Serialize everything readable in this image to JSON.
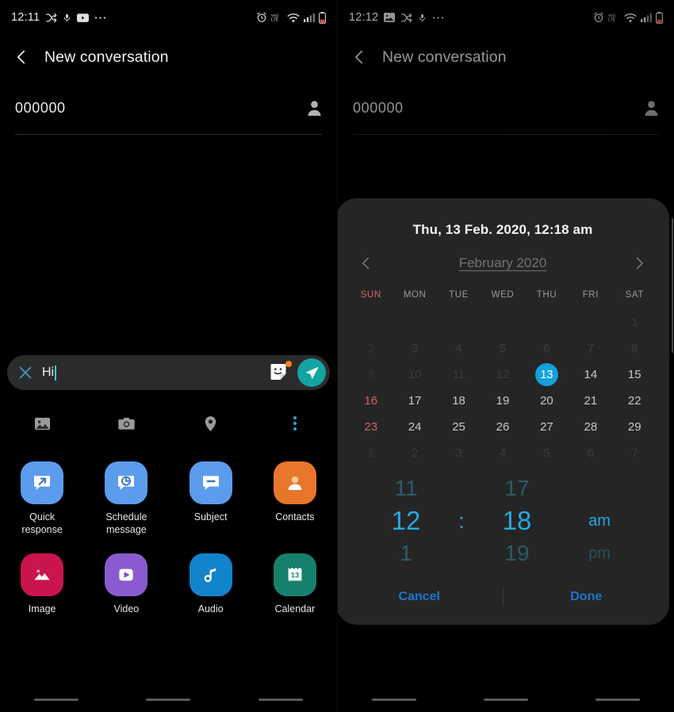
{
  "left_panel": {
    "status_bar": {
      "time": "12:11",
      "left_icons": [
        "shuffle-icon",
        "mic-icon",
        "youtube-icon",
        "more-icon"
      ],
      "right_icons": [
        "alarm-icon",
        "volte-icon",
        "wifi-icon",
        "signal-icon",
        "battery-low-icon"
      ],
      "volte_label": "Vo)) LTE"
    },
    "appbar": {
      "back": "back-chevron-icon",
      "title": "New conversation"
    },
    "recipient": {
      "value": "000000",
      "contact_icon": "person-icon"
    },
    "composer": {
      "close_icon": "close-x-icon",
      "message": "Hi",
      "sticker_icon": "sticker-icon",
      "sticker_badge": true,
      "send_icon": "send-icon",
      "send_color": "#12a3a3"
    },
    "quick_row": [
      "gallery-icon",
      "camera-icon",
      "location-icon",
      "overflow-menu-icon"
    ],
    "attachments": [
      {
        "label": "Quick\nresponse",
        "label_line1": "Quick",
        "label_line2": "response",
        "icon": "quick-response-icon",
        "color": "#5c9ced"
      },
      {
        "label": "Schedule\nmessage",
        "label_line1": "Schedule",
        "label_line2": "message",
        "icon": "schedule-message-icon",
        "color": "#5c9ced"
      },
      {
        "label": "Subject",
        "label_line1": "Subject",
        "label_line2": "",
        "icon": "subject-icon",
        "color": "#5c9ced"
      },
      {
        "label": "Contacts",
        "label_line1": "Contacts",
        "label_line2": "",
        "icon": "contacts-icon",
        "color": "#e8762a"
      },
      {
        "label": "Image",
        "label_line1": "Image",
        "label_line2": "",
        "icon": "image-icon",
        "color": "#c9144e"
      },
      {
        "label": "Video",
        "label_line1": "Video",
        "label_line2": "",
        "icon": "video-icon",
        "color": "#8a5bd0"
      },
      {
        "label": "Audio",
        "label_line1": "Audio",
        "label_line2": "",
        "icon": "audio-icon",
        "color": "#1184cc"
      },
      {
        "label": "Calendar",
        "label_line1": "Calendar",
        "label_line2": "",
        "icon": "calendar-icon",
        "color": "#17806c",
        "badge_day": "13"
      }
    ]
  },
  "right_panel": {
    "status_bar": {
      "time": "12:12",
      "left_icons": [
        "image-icon",
        "shuffle-icon",
        "mic-icon",
        "more-icon"
      ],
      "right_icons": [
        "alarm-icon",
        "volte-icon",
        "wifi-icon",
        "signal-icon",
        "battery-low-icon"
      ],
      "volte_label": "Vo)) LTE"
    },
    "appbar": {
      "back": "back-chevron-icon",
      "title": "New conversation"
    },
    "recipient": {
      "value": "000000",
      "contact_icon": "person-icon"
    },
    "dialog": {
      "title": "Thu, 13 Feb. 2020, 12:18 am",
      "prev_icon": "chevron-left-icon",
      "next_icon": "chevron-right-icon",
      "month_label": "February 2020",
      "day_headers": [
        "SUN",
        "MON",
        "TUE",
        "WED",
        "THU",
        "FRI",
        "SAT"
      ],
      "weeks": [
        [
          {
            "d": "",
            "state": "empty"
          },
          {
            "d": "",
            "state": "empty"
          },
          {
            "d": "",
            "state": "empty"
          },
          {
            "d": "",
            "state": "empty"
          },
          {
            "d": "",
            "state": "empty"
          },
          {
            "d": "",
            "state": "empty"
          },
          {
            "d": "1",
            "state": "disabled"
          }
        ],
        [
          {
            "d": "2",
            "state": "disabled-sun"
          },
          {
            "d": "3",
            "state": "disabled"
          },
          {
            "d": "4",
            "state": "disabled"
          },
          {
            "d": "5",
            "state": "disabled"
          },
          {
            "d": "6",
            "state": "disabled"
          },
          {
            "d": "7",
            "state": "disabled"
          },
          {
            "d": "8",
            "state": "disabled"
          }
        ],
        [
          {
            "d": "9",
            "state": "disabled-sun"
          },
          {
            "d": "10",
            "state": "disabled"
          },
          {
            "d": "11",
            "state": "disabled"
          },
          {
            "d": "12",
            "state": "disabled"
          },
          {
            "d": "13",
            "state": "selected"
          },
          {
            "d": "14",
            "state": "normal"
          },
          {
            "d": "15",
            "state": "normal"
          }
        ],
        [
          {
            "d": "16",
            "state": "sunday"
          },
          {
            "d": "17",
            "state": "normal"
          },
          {
            "d": "18",
            "state": "normal"
          },
          {
            "d": "19",
            "state": "normal"
          },
          {
            "d": "20",
            "state": "normal"
          },
          {
            "d": "21",
            "state": "normal"
          },
          {
            "d": "22",
            "state": "normal"
          }
        ],
        [
          {
            "d": "23",
            "state": "sunday"
          },
          {
            "d": "24",
            "state": "normal"
          },
          {
            "d": "25",
            "state": "normal"
          },
          {
            "d": "26",
            "state": "normal"
          },
          {
            "d": "27",
            "state": "normal"
          },
          {
            "d": "28",
            "state": "normal"
          },
          {
            "d": "29",
            "state": "normal"
          }
        ],
        [
          {
            "d": "1",
            "state": "disabled-sun"
          },
          {
            "d": "2",
            "state": "disabled"
          },
          {
            "d": "3",
            "state": "disabled"
          },
          {
            "d": "4",
            "state": "disabled"
          },
          {
            "d": "5",
            "state": "disabled"
          },
          {
            "d": "6",
            "state": "disabled"
          },
          {
            "d": "7",
            "state": "disabled"
          }
        ]
      ],
      "time_picker": {
        "hour_prev": "11",
        "hour": "12",
        "hour_next": "1",
        "separator": ":",
        "minute_prev": "17",
        "minute": "18",
        "minute_next": "19",
        "meridiem_selected": "am",
        "meridiem_other": "pm"
      },
      "cancel_label": "Cancel",
      "done_label": "Done",
      "accent_color": "#14a0dd",
      "action_color": "#1b76d2"
    }
  },
  "nav_bar": {
    "pills": 3
  }
}
